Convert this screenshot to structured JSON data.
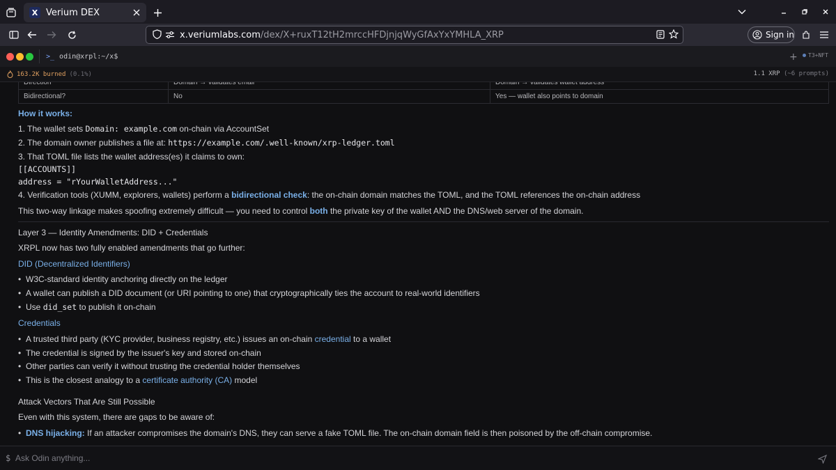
{
  "browser": {
    "tab_title": "Verium DEX",
    "tab_favicon": "X",
    "url_host": "x.veriumlabs.com",
    "url_path": "/dex/X+ruxT12tH2mrccHFDjnjqWyGfAxYxYMHLA_XRP",
    "signin_label": "Sign in"
  },
  "app": {
    "prompt": "odin@xrpl:~/x$",
    "badge": "T3+NFT",
    "burned": "163.2K burned",
    "burned_pct": "(0.1%)",
    "cost": "1.1 XRP",
    "cost_note": "(~6 prompts)"
  },
  "table": {
    "row0": [
      "Direction",
      "Domain → validates email",
      "Domain → validates wallet address"
    ],
    "row1": [
      "Bidirectional?",
      "No",
      "Yes — wallet also points to domain"
    ]
  },
  "content": {
    "how_heading": "How it works:",
    "step1_a": "1. The wallet sets ",
    "step1_code": "Domain: example.com",
    "step1_b": " on-chain via AccountSet",
    "step2_a": "2. The domain owner publishes a file at: ",
    "step2_code": "https://example.com/.well-known/xrp-ledger.toml",
    "step3": "3. That TOML file lists the wallet address(es) it claims to own:",
    "code_line1": "[[ACCOUNTS]]",
    "code_line2": "address = \"rYourWalletAddress...\"",
    "step4_a": "4. Verification tools (XUMM, explorers, wallets) perform a ",
    "step4_link": "bidirectional check",
    "step4_b": ": the on-chain domain matches the TOML, and the TOML references the on-chain address",
    "linkage_a": "This two-way linkage makes spoofing extremely difficult — you need to control ",
    "linkage_bold": "both",
    "linkage_b": " the private key of the wallet AND the DNS/web server of the domain.",
    "layer3": "Layer 3 — Identity Amendments: DID + Credentials",
    "xrpl_now": "XRPL now has two fully enabled amendments that go further:",
    "did_heading": "DID (Decentralized Identifiers)",
    "did_b1": "W3C-standard identity anchoring directly on the ledger",
    "did_b2": "A wallet can publish a DID document (or URI pointing to one) that cryptographically ties the account to real-world identifiers",
    "did_b3_a": "Use ",
    "did_b3_code": "did_set",
    "did_b3_b": " to publish it on-chain",
    "cred_heading": "Credentials",
    "cred_b1_a": "A trusted third party (KYC provider, business registry, etc.) issues an on-chain ",
    "cred_b1_link": "credential",
    "cred_b1_b": " to a wallet",
    "cred_b2": "The credential is signed by the issuer's key and stored on-chain",
    "cred_b3": "Other parties can verify it without trusting the credential holder themselves",
    "cred_b4_a": "This is the closest analogy to a ",
    "cred_b4_link": "certificate authority (CA)",
    "cred_b4_b": " model",
    "attack_heading": "Attack Vectors That Are Still Possible",
    "attack_intro": "Even with this system, there are gaps to be aware of:",
    "dns_label": "DNS hijacking:",
    "dns_text": " If an attacker compromises the domain's DNS, they can serve a fake TOML file. The on-chain domain field is then poisoned by the off-chain compromise."
  },
  "input": {
    "placeholder": "Ask Odin anything..."
  },
  "colors": {
    "accent": "#7ab0e8",
    "burned": "#e0a060",
    "dot_red": "#ff5f57",
    "dot_yellow": "#febc2e",
    "dot_green": "#28c840"
  }
}
